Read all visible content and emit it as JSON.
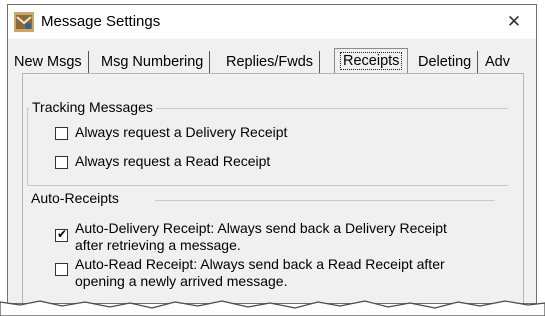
{
  "window": {
    "title": "Message Settings",
    "close_glyph": "✕"
  },
  "tabs": [
    {
      "label": "New Msgs",
      "active": false
    },
    {
      "label": "Msg Numbering",
      "active": false
    },
    {
      "label": "Replies/Fwds",
      "active": false
    },
    {
      "label": "Receipts",
      "active": true
    },
    {
      "label": "Deleting",
      "active": false
    },
    {
      "label": "Adv",
      "active": false
    }
  ],
  "tracking": {
    "label": "Tracking Messages",
    "options": [
      {
        "label": "Always request a Delivery Receipt",
        "checked": false
      },
      {
        "label": "Always request a Read Receipt",
        "checked": false
      }
    ]
  },
  "auto_receipts": {
    "label": "Auto-Receipts",
    "options": [
      {
        "line1": "Auto-Delivery Receipt:  Always send back a Delivery Receipt",
        "line2": "after retrieving a message.",
        "checked": true
      },
      {
        "line1": "Auto-Read Receipt:  Always send back a Read Receipt after",
        "line2": "opening a newly arrived message.",
        "checked": false
      }
    ]
  },
  "icons": {
    "app": "mail-app-icon",
    "close": "close-icon",
    "check": "checkmark-icon"
  }
}
